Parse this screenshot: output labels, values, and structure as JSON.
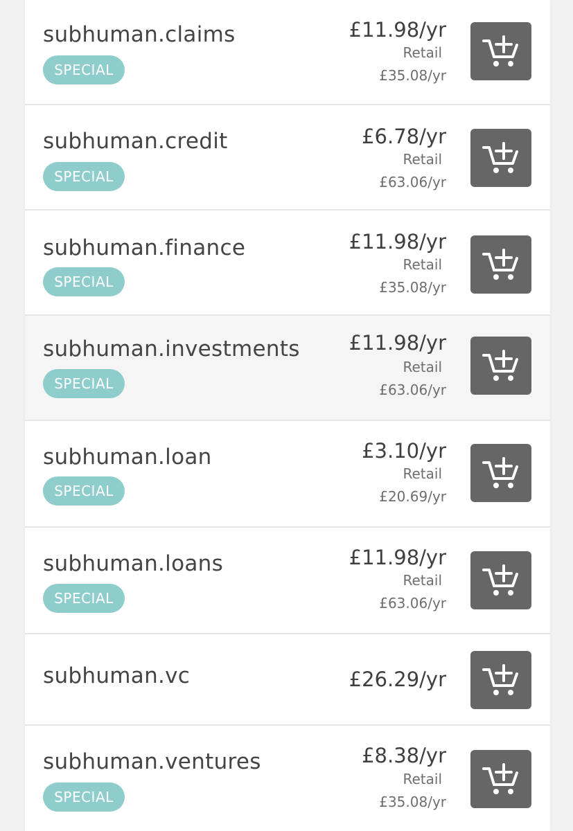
{
  "colors": {
    "badge": "#8ecdcb",
    "cart_button": "#666666",
    "text_primary": "#444444",
    "text_secondary": "#6e6e6e"
  },
  "items": [
    {
      "domain": "subhuman.claims",
      "badge": "SPECIAL",
      "price": "£11.98/yr",
      "retail_label": "Retail",
      "retail_price": "£35.08/yr",
      "cart_icon": "add-to-cart-icon"
    },
    {
      "domain": "subhuman.credit",
      "badge": "SPECIAL",
      "price": "£6.78/yr",
      "retail_label": "Retail",
      "retail_price": "£63.06/yr",
      "cart_icon": "add-to-cart-icon"
    },
    {
      "domain": "subhuman.finance",
      "badge": "SPECIAL",
      "price": "£11.98/yr",
      "retail_label": "Retail",
      "retail_price": "£35.08/yr",
      "cart_icon": "add-to-cart-icon"
    },
    {
      "domain": "subhuman.investments",
      "badge": "SPECIAL",
      "price": "£11.98/yr",
      "retail_label": "Retail",
      "retail_price": "£63.06/yr",
      "cart_icon": "add-to-cart-icon"
    },
    {
      "domain": "subhuman.loan",
      "badge": "SPECIAL",
      "price": "£3.10/yr",
      "retail_label": "Retail",
      "retail_price": "£20.69/yr",
      "cart_icon": "add-to-cart-icon"
    },
    {
      "domain": "subhuman.loans",
      "badge": "SPECIAL",
      "price": "£11.98/yr",
      "retail_label": "Retail",
      "retail_price": "£63.06/yr",
      "cart_icon": "add-to-cart-icon"
    },
    {
      "domain": "subhuman.vc",
      "price": "£26.29/yr",
      "cart_icon": "add-to-cart-icon"
    },
    {
      "domain": "subhuman.ventures",
      "badge": "SPECIAL",
      "price": "£8.38/yr",
      "retail_label": "Retail",
      "retail_price": "£35.08/yr",
      "cart_icon": "add-to-cart-icon"
    }
  ]
}
